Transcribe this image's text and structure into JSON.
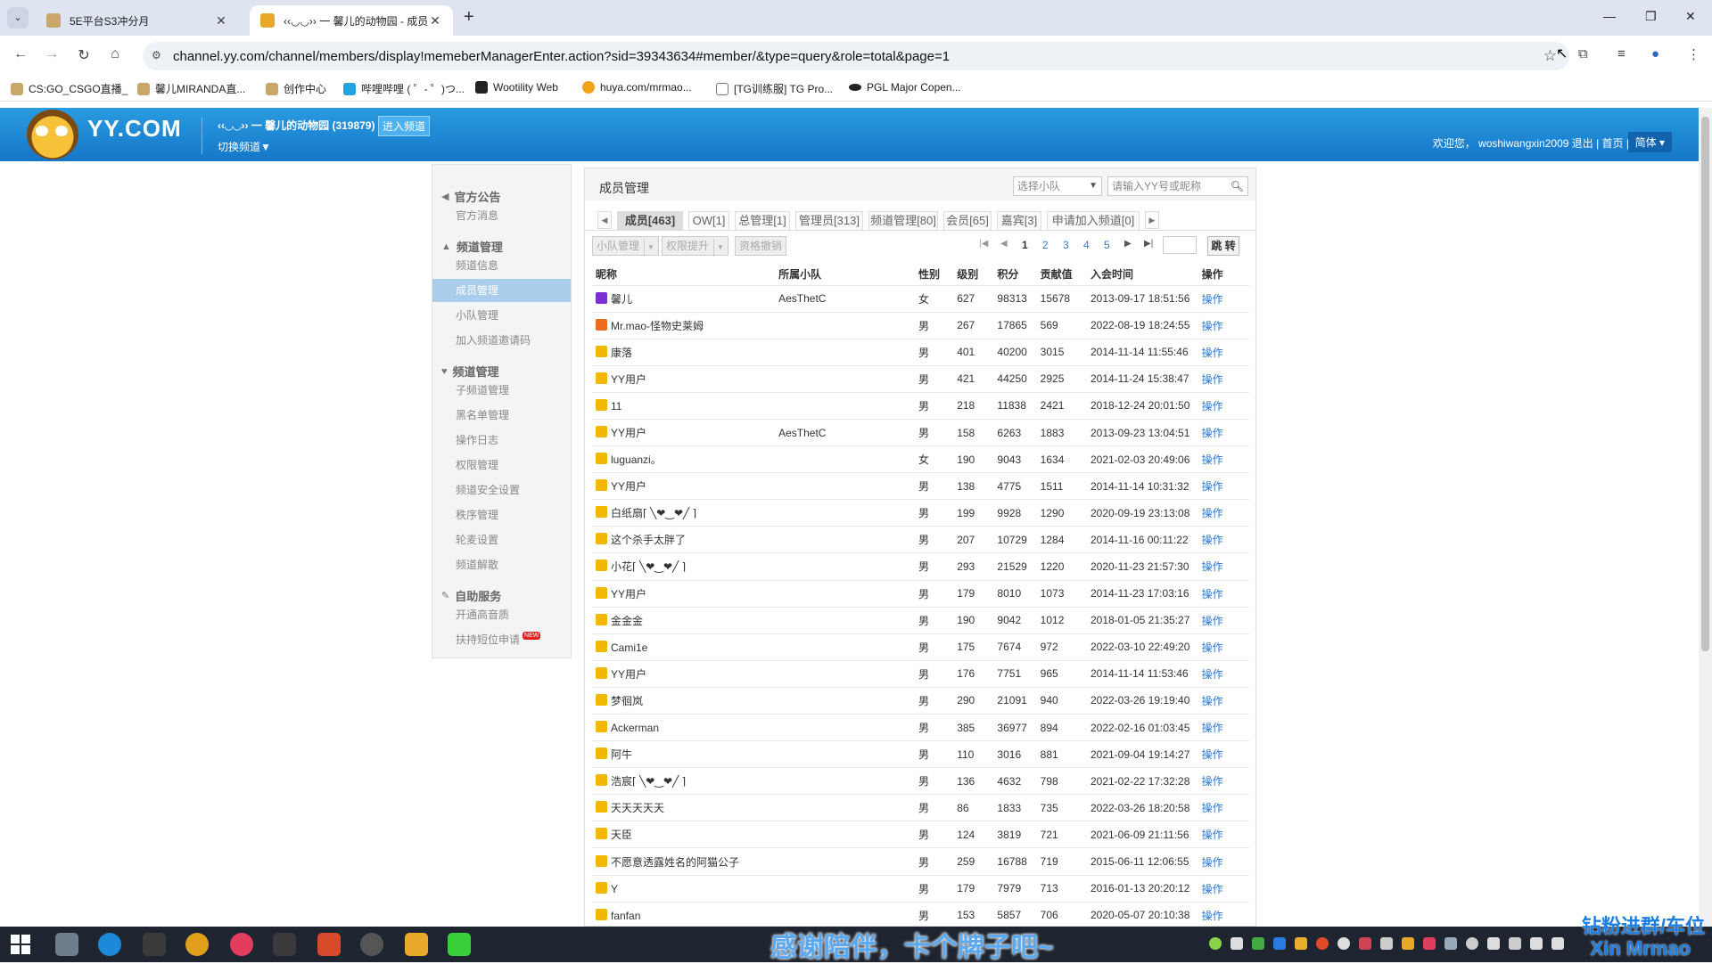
{
  "browser": {
    "tabs": [
      {
        "title": "5E平台S3冲分月",
        "active": false
      },
      {
        "title": "‹‹◡◡›› 一 馨儿的动物园 - 成员管",
        "active": true
      }
    ],
    "url": "channel.yy.com/channel/members/display!memeberManagerEnter.action?sid=39343634#member/&type=query&role=total&page=1",
    "bookmarks": [
      "CS:GO_CSGO直播_",
      "馨儿MIRANDA直...",
      "创作中心",
      "哔哩哔哩 ( ゜- ゜)つ...",
      "Wootility Web",
      "huya.com/mrmao...",
      "[TG训练服] TG Pro...",
      "PGL Major Copen..."
    ]
  },
  "header": {
    "logo": "YY.COM",
    "channel_name": "‹‹◡◡›› 一 馨儿的动物园 (319879)",
    "enter_channel": "进入频道",
    "switch_channel": "切换频道▼",
    "welcome": "欢迎您， woshiwangxin2009 退出 | 首页 |",
    "lang": "简体 ▾"
  },
  "sidebar": {
    "groups": [
      {
        "label": "官方公告",
        "items": [
          "官方消息"
        ]
      },
      {
        "label": "频道管理",
        "items": [
          "频道信息",
          "成员管理",
          "小队管理",
          "加入频道邀请码"
        ]
      },
      {
        "label": "频道管理",
        "items": [
          "子频道管理",
          "黑名单管理",
          "操作日志",
          "权限管理",
          "频道安全设置",
          "秩序管理",
          "轮麦设置",
          "频道解散"
        ]
      },
      {
        "label": "自助服务",
        "items": [
          "开通高音质",
          "扶持短位申请"
        ]
      }
    ],
    "new_badge": "NEW"
  },
  "panel": {
    "title": "成员管理",
    "team_select": "选择小队",
    "search_placeholder": "请输入YY号或昵称",
    "tabs": [
      "成员[463]",
      "OW[1]",
      "总管理[1]",
      "管理员[313]",
      "频道管理[80]",
      "会员[65]",
      "嘉宾[3]",
      "申请加入频道[0]"
    ],
    "actions": {
      "team_manage": "小队管理",
      "promote": "权限提升",
      "revoke": "资格撤销"
    },
    "pages": [
      "1",
      "2",
      "3",
      "4",
      "5"
    ],
    "jump": "跳 转",
    "columns": [
      "昵称",
      "所属小队",
      "性别",
      "级别",
      "积分",
      "贡献值",
      "入会时间",
      "操作"
    ],
    "rows": [
      {
        "name": "馨儿",
        "team": "AesThetC",
        "sex": "女",
        "level": "627",
        "points": "98313",
        "contrib": "15678",
        "time": "2013-09-17 18:51:56",
        "op": "操作",
        "icon": "#7a2fd0"
      },
      {
        "name": "Mr.mao-怪物史莱姆",
        "team": "",
        "sex": "男",
        "level": "267",
        "points": "17865",
        "contrib": "569",
        "time": "2022-08-19 18:24:55",
        "op": "操作",
        "icon": "#ee6a1e"
      },
      {
        "name": "康落",
        "team": "",
        "sex": "男",
        "level": "401",
        "points": "40200",
        "contrib": "3015",
        "time": "2014-11-14 11:55:46",
        "op": "操作",
        "icon": "#f0b800"
      },
      {
        "name": "YY用户",
        "team": "",
        "sex": "男",
        "level": "421",
        "points": "44250",
        "contrib": "2925",
        "time": "2014-11-24 15:38:47",
        "op": "操作",
        "icon": "#f0b800"
      },
      {
        "name": "11",
        "team": "",
        "sex": "男",
        "level": "218",
        "points": "11838",
        "contrib": "2421",
        "time": "2018-12-24 20:01:50",
        "op": "操作",
        "icon": "#f0b800"
      },
      {
        "name": "YY用户",
        "team": "AesThetC",
        "sex": "男",
        "level": "158",
        "points": "6263",
        "contrib": "1883",
        "time": "2013-09-23 13:04:51",
        "op": "操作",
        "icon": "#f0b800"
      },
      {
        "name": "luguanzi。",
        "team": "",
        "sex": "女",
        "level": "190",
        "points": "9043",
        "contrib": "1634",
        "time": "2021-02-03 20:49:06",
        "op": "操作",
        "icon": "#f0b800"
      },
      {
        "name": "YY用户",
        "team": "",
        "sex": "男",
        "level": "138",
        "points": "4775",
        "contrib": "1511",
        "time": "2014-11-14 10:31:32",
        "op": "操作",
        "icon": "#f0b800"
      },
      {
        "name": "白纸扇⌈ ╲❤‿❤╱ ⌉",
        "team": "",
        "sex": "男",
        "level": "199",
        "points": "9928",
        "contrib": "1290",
        "time": "2020-09-19 23:13:08",
        "op": "操作",
        "icon": "#f0b800"
      },
      {
        "name": "这个杀手太胖了",
        "team": "",
        "sex": "男",
        "level": "207",
        "points": "10729",
        "contrib": "1284",
        "time": "2014-11-16 00:11:22",
        "op": "操作",
        "icon": "#f0b800"
      },
      {
        "name": "小花⌈ ╲❤‿❤╱ ⌉",
        "team": "",
        "sex": "男",
        "level": "293",
        "points": "21529",
        "contrib": "1220",
        "time": "2020-11-23 21:57:30",
        "op": "操作",
        "icon": "#f0b800"
      },
      {
        "name": "YY用户",
        "team": "",
        "sex": "男",
        "level": "179",
        "points": "8010",
        "contrib": "1073",
        "time": "2014-11-23 17:03:16",
        "op": "操作",
        "icon": "#f0b800"
      },
      {
        "name": "金金金",
        "team": "",
        "sex": "男",
        "level": "190",
        "points": "9042",
        "contrib": "1012",
        "time": "2018-01-05 21:35:27",
        "op": "操作",
        "icon": "#f0b800"
      },
      {
        "name": "Cami1e",
        "team": "",
        "sex": "男",
        "level": "175",
        "points": "7674",
        "contrib": "972",
        "time": "2022-03-10 22:49:20",
        "op": "操作",
        "icon": "#f0b800"
      },
      {
        "name": "YY用户",
        "team": "",
        "sex": "男",
        "level": "176",
        "points": "7751",
        "contrib": "965",
        "time": "2014-11-14 11:53:46",
        "op": "操作",
        "icon": "#f0b800"
      },
      {
        "name": "梦徊岚",
        "team": "",
        "sex": "男",
        "level": "290",
        "points": "21091",
        "contrib": "940",
        "time": "2022-03-26 19:19:40",
        "op": "操作",
        "icon": "#f0b800"
      },
      {
        "name": "Ackerman",
        "team": "",
        "sex": "男",
        "level": "385",
        "points": "36977",
        "contrib": "894",
        "time": "2022-02-16 01:03:45",
        "op": "操作",
        "icon": "#f0b800"
      },
      {
        "name": "阿牛",
        "team": "",
        "sex": "男",
        "level": "110",
        "points": "3016",
        "contrib": "881",
        "time": "2021-09-04 19:14:27",
        "op": "操作",
        "icon": "#f0b800"
      },
      {
        "name": "浩宸⌈ ╲❤‿❤╱ ⌉",
        "team": "",
        "sex": "男",
        "level": "136",
        "points": "4632",
        "contrib": "798",
        "time": "2021-02-22 17:32:28",
        "op": "操作",
        "icon": "#f0b800"
      },
      {
        "name": "天天天天天",
        "team": "",
        "sex": "男",
        "level": "86",
        "points": "1833",
        "contrib": "735",
        "time": "2022-03-26 18:20:58",
        "op": "操作",
        "icon": "#f0b800"
      },
      {
        "name": "天臣",
        "team": "",
        "sex": "男",
        "level": "124",
        "points": "3819",
        "contrib": "721",
        "time": "2021-06-09 21:11:56",
        "op": "操作",
        "icon": "#f0b800"
      },
      {
        "name": "不愿意透露姓名的阿猫公子",
        "team": "",
        "sex": "男",
        "level": "259",
        "points": "16788",
        "contrib": "719",
        "time": "2015-06-11 12:06:55",
        "op": "操作",
        "icon": "#f0b800"
      },
      {
        "name": "Y",
        "team": "",
        "sex": "男",
        "level": "179",
        "points": "7979",
        "contrib": "713",
        "time": "2016-01-13 20:20:12",
        "op": "操作",
        "icon": "#f0b800"
      },
      {
        "name": "fanfan",
        "team": "",
        "sex": "男",
        "level": "153",
        "points": "5857",
        "contrib": "706",
        "time": "2020-05-07 20:10:38",
        "op": "操作",
        "icon": "#f0b800"
      }
    ]
  },
  "overlay": {
    "caption": "感谢陪伴，卡个牌子吧~",
    "watermark_line1": "钻粉进群/车位",
    "watermark_line2": "Xin Mrmao"
  },
  "colors": {
    "header_blue": "#1a86d6",
    "link_blue": "#2c77d0",
    "sidebar_active": "#a9cdeb"
  }
}
